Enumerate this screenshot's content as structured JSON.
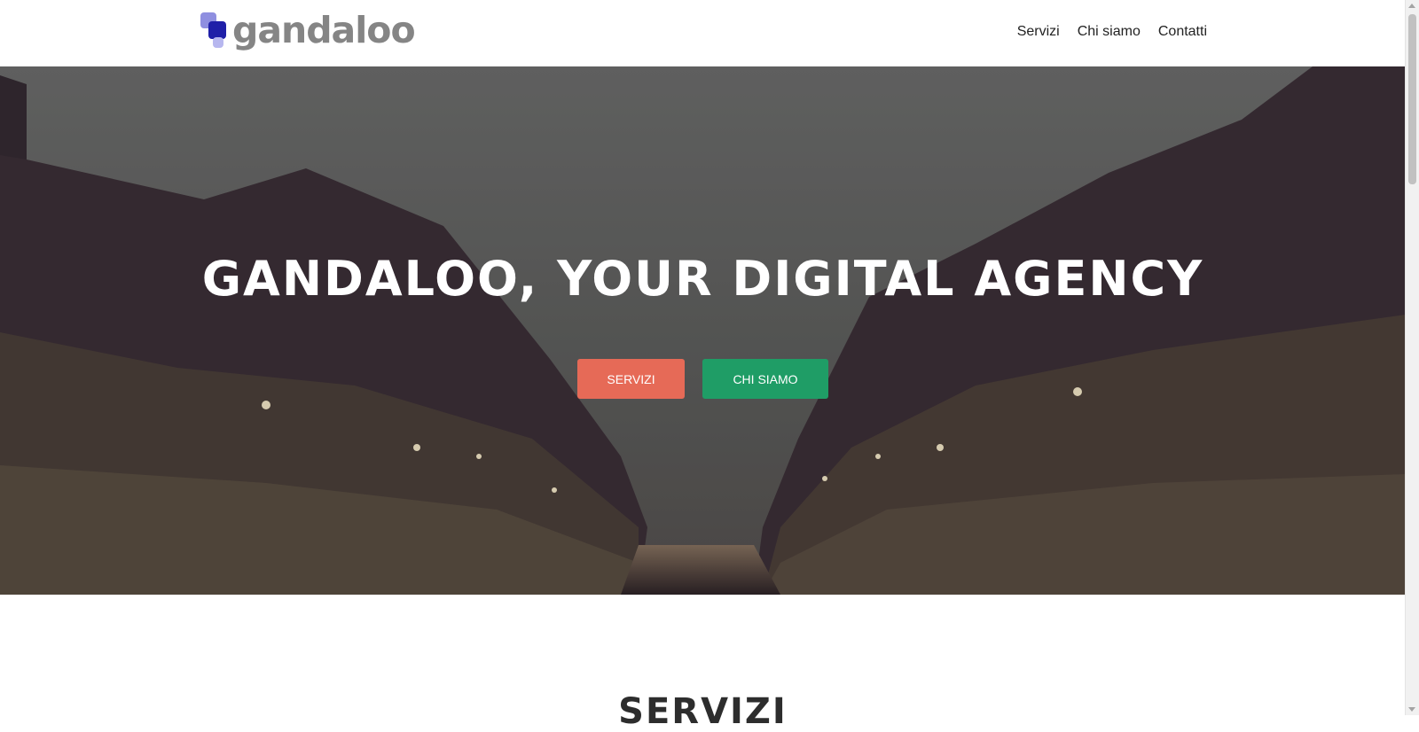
{
  "header": {
    "logo_text": "gandaloo",
    "nav": [
      {
        "label": "Servizi"
      },
      {
        "label": "Chi siamo"
      },
      {
        "label": "Contatti"
      }
    ]
  },
  "hero": {
    "title": "GANDALOO, YOUR DIGITAL AGENCY",
    "buttons": {
      "servizi_label": "SERVIZI",
      "chi_siamo_label": "CHI SIAMO"
    }
  },
  "section": {
    "title": "SERVIZI"
  },
  "colors": {
    "servizi_button": "#e66a57",
    "chi_siamo_button": "#1f9d66",
    "logo_primary": "#1f1fa8",
    "logo_text": "#858585"
  }
}
